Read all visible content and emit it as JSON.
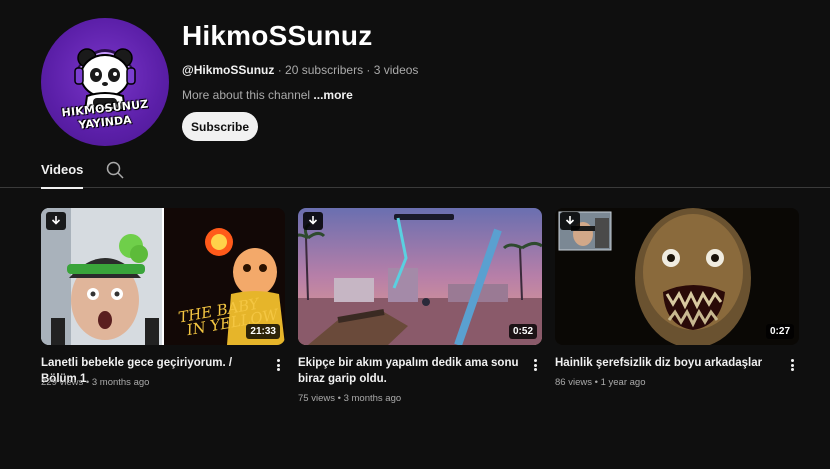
{
  "channel": {
    "title": "HikmoSSunuz",
    "handle": "@HikmoSSunuz",
    "meta_rest": " · 20 subscribers · 3 videos",
    "about_text": "More about this channel ",
    "about_more": "...more",
    "subscribe_label": "Subscribe",
    "avatar_text_line1": "HIKMOSUNUZ",
    "avatar_text_line2": "YAYINDA"
  },
  "tabs": {
    "videos_label": "Videos",
    "search_icon": "search-icon"
  },
  "videos": [
    {
      "title": "Lanetli bebekle gece geçiriyorum. / Bölüm 1",
      "views": "229 views",
      "age": "3 months ago",
      "duration": "21:33",
      "thumb_text_1": "THE BABY",
      "thumb_text_2": "IN YELLOW"
    },
    {
      "title": "Ekipçe bir akım yapalım dedik ama sonu biraz garip oldu.",
      "views": "75 views",
      "age": "3 months ago",
      "duration": "0:52"
    },
    {
      "title": "Hainlik şerefsizlik diz boyu arkadaşlar",
      "views": "86 views",
      "age": "1 year ago",
      "duration": "0:27"
    }
  ],
  "separator": " • ",
  "colors": {
    "background": "#0f0f0f",
    "avatar_purple": "#5b1fa8",
    "text_primary": "#f1f1f1",
    "text_secondary": "#aaaaaa"
  }
}
